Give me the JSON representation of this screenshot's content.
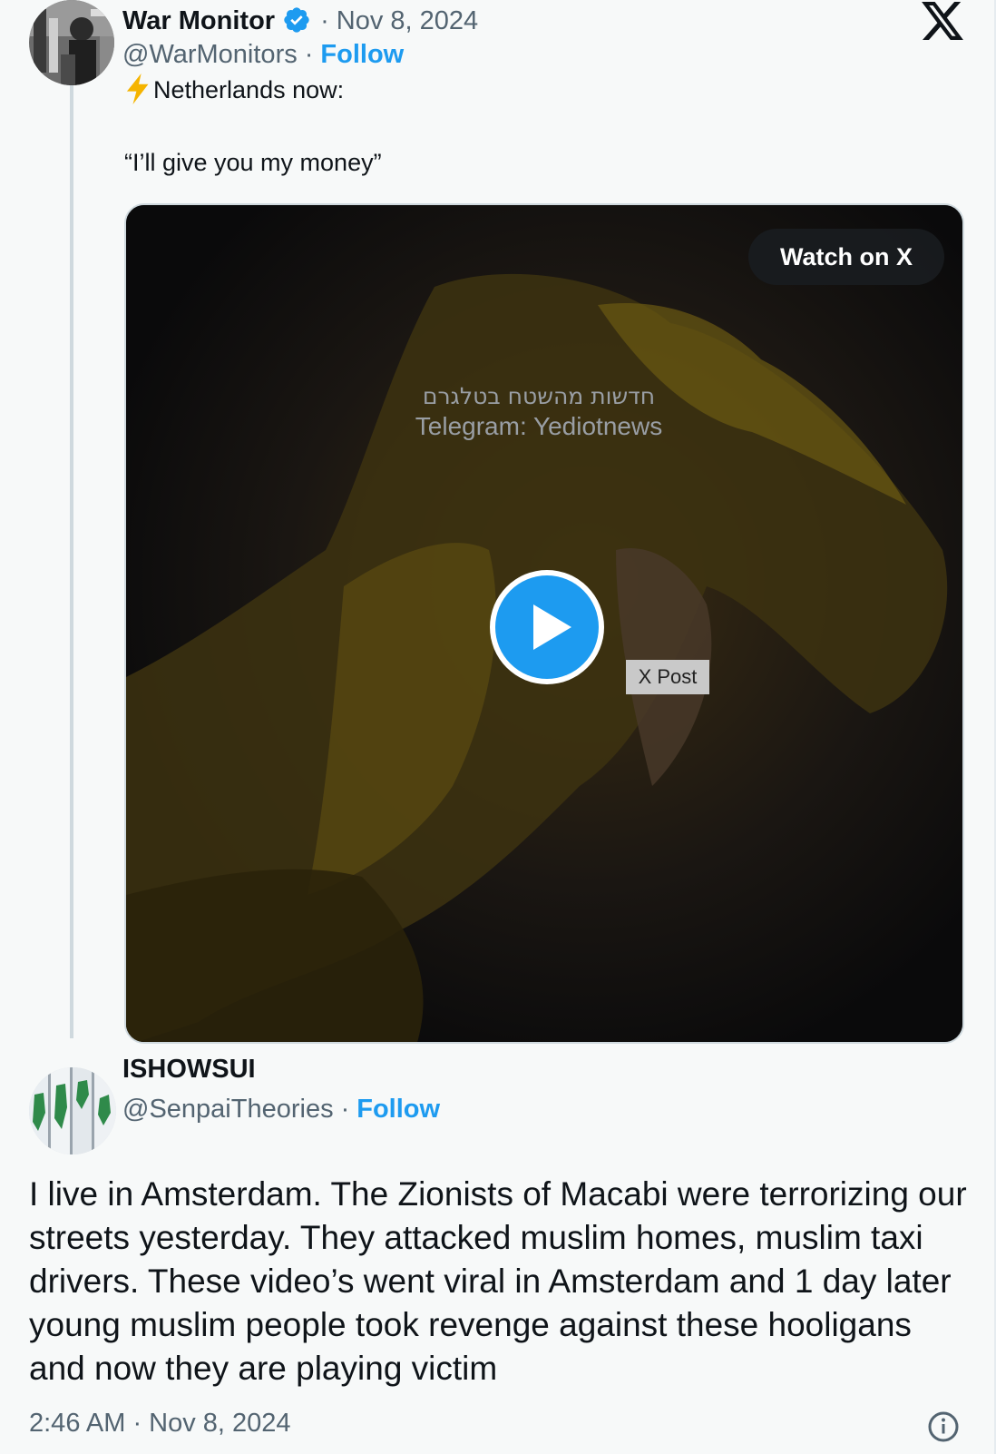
{
  "original_tweet": {
    "display_name": "War Monitor",
    "date_prefix": "· Nov 8, 2024",
    "handle": "@WarMonitors",
    "separator": "·",
    "follow_label": "Follow",
    "line1": "Netherlands now:",
    "line2": "“I’ll give you my money”",
    "media": {
      "watch_label": "Watch on X",
      "watermark_hebrew": "חדשות מהשטח בטלגרם",
      "watermark_telegram": "Telegram: Yediotnews",
      "tag_label": "X Post"
    }
  },
  "reply": {
    "display_name": "ISHOWSUI",
    "handle": "@SenpaiTheories",
    "separator": "·",
    "follow_label": "Follow",
    "text": "I live in Amsterdam. The Zionists of Macabi were terrorizing our streets yesterday. They attacked muslim homes, muslim taxi drivers. These video’s went viral in Amsterdam and 1 day later young muslim people took revenge against these hooligans and now they are playing victim",
    "timestamp": "2:46 AM · Nov 8, 2024"
  },
  "colors": {
    "accent": "#1d9bf0",
    "text": "#0f1419",
    "muted": "#536471",
    "background": "#f7f9f9"
  },
  "icons": [
    "verified-badge-icon",
    "x-logo-icon",
    "lightning-icon",
    "play-icon",
    "info-icon"
  ]
}
